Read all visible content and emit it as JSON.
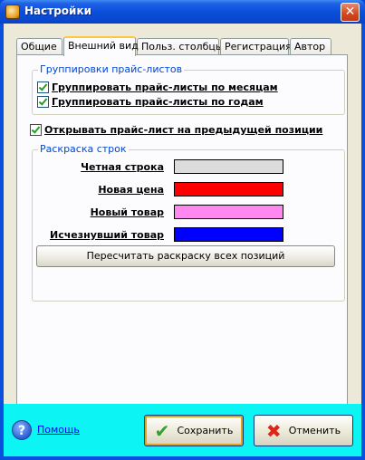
{
  "window": {
    "title": "Настройки",
    "app_icon": "settings-app-icon",
    "close_glyph": "✕"
  },
  "tabs": [
    {
      "label": "Общие",
      "active": false
    },
    {
      "label": "Внешний вид",
      "active": true
    },
    {
      "label": "Польз. столбцы",
      "active": false
    },
    {
      "label": "Регистрация",
      "active": false
    },
    {
      "label": "Автор",
      "active": false
    }
  ],
  "pricelist_group": {
    "title": "Группировки прайс-листов",
    "by_month": {
      "label": "Группировать прайс-листы по месяцам",
      "checked": true
    },
    "by_year": {
      "label": "Группировать прайс-листы по годам",
      "checked": true
    }
  },
  "open_prev": {
    "label": "Открывать прайс-лист на предыдущей позиции",
    "checked": true
  },
  "row_colors": {
    "title": "Раскраска строк",
    "items": [
      {
        "label": "Четная строка",
        "color": "#dcdcdc"
      },
      {
        "label": "Новая цена",
        "color": "#ff0000"
      },
      {
        "label": "Новый товар",
        "color": "#ff88f0"
      },
      {
        "label": "Исчезнувший товар",
        "color": "#0000ff"
      }
    ],
    "recalc_button": "Пересчитать раскраску всех позиций"
  },
  "footer": {
    "help_label": "Помощь",
    "help_icon_glyph": "?",
    "save_label": "Сохранить",
    "save_icon_glyph": "✔",
    "cancel_label": "Отменить",
    "cancel_icon_glyph": "✖"
  },
  "colors": {
    "titlebar": "#0a4fde",
    "footer_bg": "#0cf4f4",
    "groupbox_title": "#0046d5"
  }
}
